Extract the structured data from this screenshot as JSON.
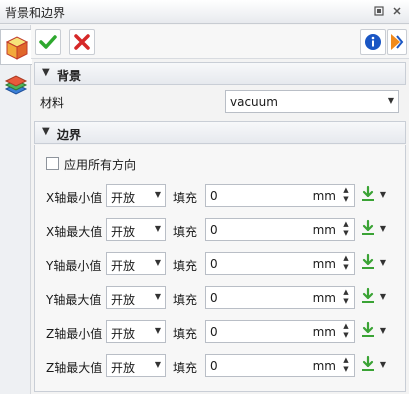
{
  "window": {
    "title": "背景和边界"
  },
  "background_section": {
    "title": "背景",
    "material_label": "材料",
    "material_value": "vacuum"
  },
  "boundary_section": {
    "title": "边界",
    "apply_all_label": "应用所有方向",
    "apply_all_checked": false,
    "rows": [
      {
        "axis_label": "X轴最小值",
        "type": "开放",
        "fill_label": "填充",
        "value": "0",
        "unit": "mm"
      },
      {
        "axis_label": "X轴最大值",
        "type": "开放",
        "fill_label": "填充",
        "value": "0",
        "unit": "mm"
      },
      {
        "axis_label": "Y轴最小值",
        "type": "开放",
        "fill_label": "填充",
        "value": "0",
        "unit": "mm"
      },
      {
        "axis_label": "Y轴最大值",
        "type": "开放",
        "fill_label": "填充",
        "value": "0",
        "unit": "mm"
      },
      {
        "axis_label": "Z轴最小值",
        "type": "开放",
        "fill_label": "填充",
        "value": "0",
        "unit": "mm"
      },
      {
        "axis_label": "Z轴最大值",
        "type": "开放",
        "fill_label": "填充",
        "value": "0",
        "unit": "mm"
      }
    ]
  },
  "colors": {
    "confirm_green": "#2ea82e",
    "cancel_red": "#d62828",
    "info_blue": "#1a56c4",
    "pick_green": "#3aa335"
  }
}
